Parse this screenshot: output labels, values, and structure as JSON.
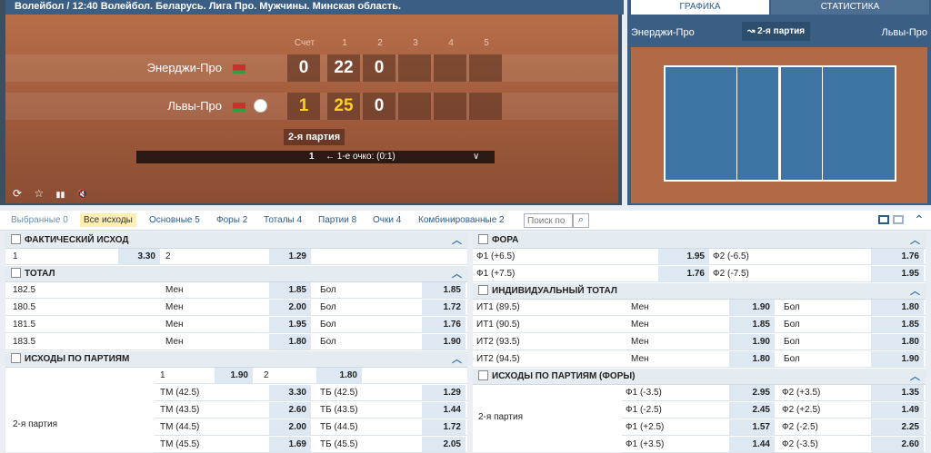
{
  "header": {
    "title": "Волейбол  /  12:40 Волейбол. Беларусь. Лига Про. Мужчины. Минская область."
  },
  "scoreboard": {
    "headers": [
      "Счет",
      "1",
      "2",
      "3",
      "4",
      "5"
    ],
    "team1": {
      "name": "Энерджи-Про",
      "score": "0",
      "set1": "22",
      "set2": "0"
    },
    "team2": {
      "name": "Львы-Про",
      "score": "1",
      "set1": "25",
      "set2": "0"
    },
    "part": "2-я партия",
    "point_bar": {
      "num": "1",
      "text": "← 1-е очко: (0:1)",
      "chevron": "∨"
    },
    "tools": [
      "⟳",
      "☆",
      "▮▮",
      "🔇"
    ]
  },
  "graphic": {
    "tab1": "ГРАФИКА",
    "tab2": "СТАТИСТИКА",
    "team1": "Энерджи-Про",
    "team2": "Львы-Про",
    "part": "↝ 2-я партия"
  },
  "bets_bar": {
    "tabs": [
      "Выбранные 0",
      "Все исходы",
      "Основные 5",
      "Форы 2",
      "Тоталы 4",
      "Партии 8",
      "Очки 4",
      "Комбинированные 2"
    ],
    "search_placeholder": "Поиск по"
  },
  "left": {
    "m1": {
      "title": "ФАКТИЧЕСКИЙ ИСХОД",
      "row": {
        "l1": "1",
        "o1": "3.30",
        "l2": "2",
        "o2": "1.29"
      }
    },
    "m2": {
      "title": "ТОТАЛ",
      "rows": [
        {
          "name": "182.5",
          "a": "Мен",
          "ao": "1.85",
          "b": "Бол",
          "bo": "1.85"
        },
        {
          "name": "180.5",
          "a": "Мен",
          "ao": "2.00",
          "b": "Бол",
          "bo": "1.72"
        },
        {
          "name": "181.5",
          "a": "Мен",
          "ao": "1.95",
          "b": "Бол",
          "bo": "1.76"
        },
        {
          "name": "183.5",
          "a": "Мен",
          "ao": "1.80",
          "b": "Бол",
          "bo": "1.90"
        }
      ]
    },
    "m3": {
      "title": "ИСХОДЫ ПО ПАРТИЯМ",
      "first": {
        "l1": "1",
        "o1": "1.90",
        "l2": "2",
        "o2": "1.80"
      },
      "part": "2-я партия",
      "rows": [
        {
          "a": "ТМ (42.5)",
          "ao": "3.30",
          "b": "ТБ (42.5)",
          "bo": "1.29"
        },
        {
          "a": "ТМ (43.5)",
          "ao": "2.60",
          "b": "ТБ (43.5)",
          "bo": "1.44"
        },
        {
          "a": "ТМ (44.5)",
          "ao": "2.00",
          "b": "ТБ (44.5)",
          "bo": "1.72"
        },
        {
          "a": "ТМ (45.5)",
          "ao": "1.69",
          "b": "ТБ (45.5)",
          "bo": "2.05"
        }
      ]
    }
  },
  "right": {
    "m1": {
      "title": "ФОРА",
      "rows": [
        {
          "a": "Ф1 (+6.5)",
          "ao": "1.95",
          "b": "Ф2 (-6.5)",
          "bo": "1.76"
        },
        {
          "a": "Ф1 (+7.5)",
          "ao": "1.76",
          "b": "Ф2 (-7.5)",
          "bo": "1.95"
        }
      ]
    },
    "m2": {
      "title": "ИНДИВИДУАЛЬНЫЙ ТОТАЛ",
      "rows": [
        {
          "name": "ИТ1 (89.5)",
          "a": "Мен",
          "ao": "1.90",
          "b": "Бол",
          "bo": "1.80"
        },
        {
          "name": "ИТ1 (90.5)",
          "a": "Мен",
          "ao": "1.85",
          "b": "Бол",
          "bo": "1.85"
        },
        {
          "name": "ИТ2 (93.5)",
          "a": "Мен",
          "ao": "1.90",
          "b": "Бол",
          "bo": "1.80"
        },
        {
          "name": "ИТ2 (94.5)",
          "a": "Мен",
          "ao": "1.80",
          "b": "Бол",
          "bo": "1.90"
        }
      ]
    },
    "m3": {
      "title": "ИСХОДЫ ПО ПАРТИЯМ (ФОРЫ)",
      "part": "2-я партия",
      "rows": [
        {
          "a": "Ф1 (-3.5)",
          "ao": "2.95",
          "b": "Ф2 (+3.5)",
          "bo": "1.35"
        },
        {
          "a": "Ф1 (-2.5)",
          "ao": "2.45",
          "b": "Ф2 (+2.5)",
          "bo": "1.49"
        },
        {
          "a": "Ф1 (+2.5)",
          "ao": "1.57",
          "b": "Ф2 (-2.5)",
          "bo": "2.25"
        },
        {
          "a": "Ф1 (+3.5)",
          "ao": "1.44",
          "b": "Ф2 (-3.5)",
          "bo": "2.60"
        }
      ]
    }
  }
}
